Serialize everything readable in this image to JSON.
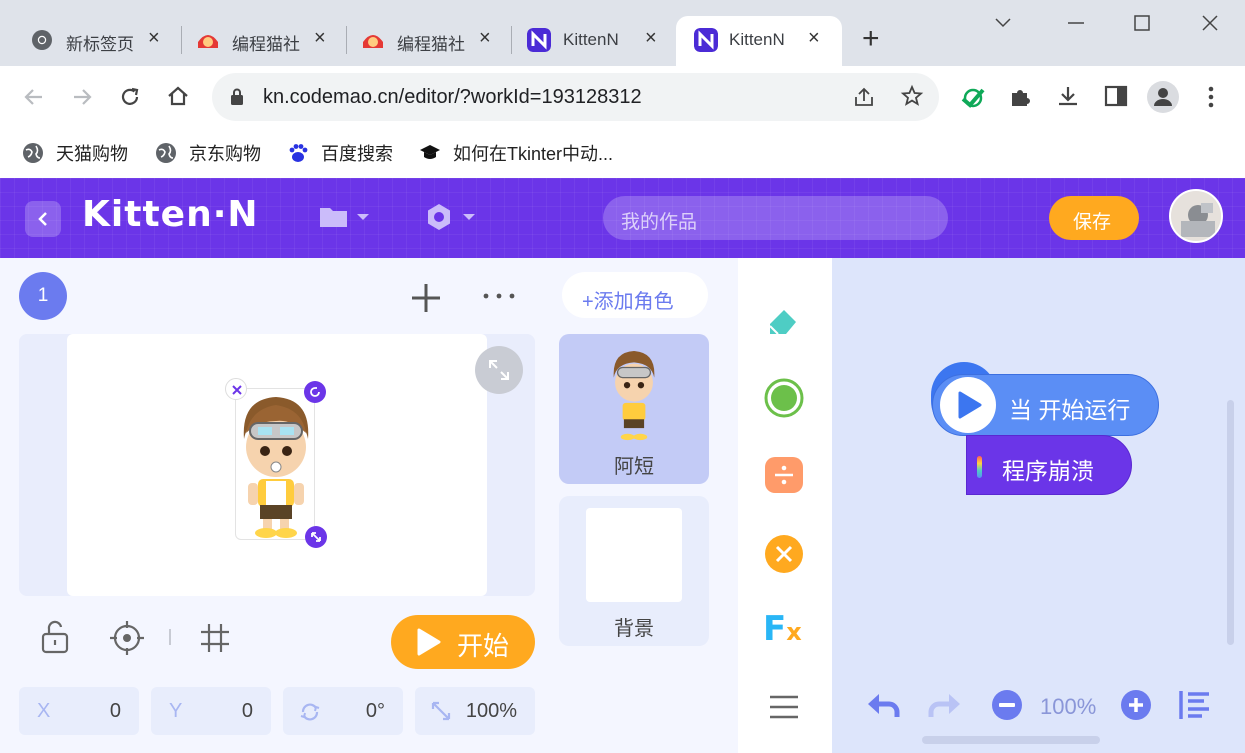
{
  "browser": {
    "tabs": [
      {
        "label": "新标签页",
        "icon": "chrome-icon"
      },
      {
        "label": "编程猫社",
        "icon": "codemao-icon"
      },
      {
        "label": "编程猫社",
        "icon": "codemao-icon"
      },
      {
        "label": "KittenN",
        "icon": "kittenn-icon"
      },
      {
        "label": "KittenN",
        "icon": "kittenn-icon"
      }
    ],
    "close_glyph": "×",
    "new_tab_glyph": "+",
    "url": "kn.codemao.cn/editor/?workId=193128312",
    "bookmarks": [
      {
        "label": "天猫购物",
        "icon": "globe-icon"
      },
      {
        "label": "京东购物",
        "icon": "globe-icon"
      },
      {
        "label": "百度搜索",
        "icon": "baidu-paw-icon"
      },
      {
        "label": "如何在Tkinter中动...",
        "icon": "graduation-cap-icon"
      }
    ]
  },
  "app": {
    "logo": "Kitten·N",
    "search_placeholder": "我的作品",
    "save_label": "保存",
    "brand_color": "#6b35e8",
    "accent_color": "#ffa91f"
  },
  "stage": {
    "screen_number": "1",
    "start_label": "开始",
    "fields": [
      {
        "label": "X",
        "value": "0"
      },
      {
        "label": "Y",
        "value": "0"
      },
      {
        "label": "rotate",
        "value": "0°"
      },
      {
        "label": "scale",
        "value": "100%"
      }
    ]
  },
  "sprites": {
    "add_label": "+添加角色",
    "items": [
      {
        "name": "阿短"
      },
      {
        "name": "背景"
      }
    ]
  },
  "blocks": {
    "event_label": "当 开始运行",
    "custom_label": "程序崩溃"
  },
  "workspace": {
    "zoom": "100%"
  }
}
